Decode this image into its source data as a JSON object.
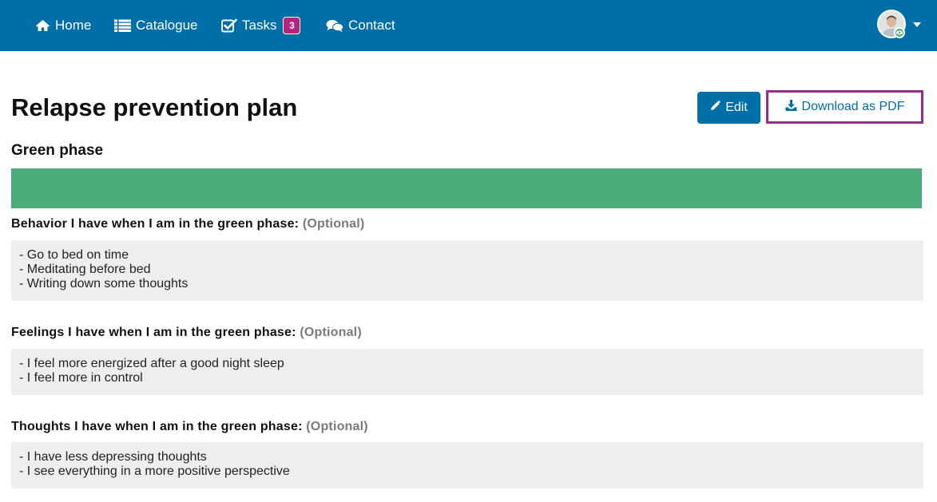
{
  "nav": {
    "home": "Home",
    "catalogue": "Catalogue",
    "tasks": "Tasks",
    "tasks_badge": "3",
    "contact": "Contact"
  },
  "page": {
    "title": "Relapse prevention plan",
    "edit_label": "Edit",
    "download_label": "Download as PDF"
  },
  "phase": {
    "title": "Green phase",
    "color": "#4aab79"
  },
  "fields": [
    {
      "label": "Behavior I have when I am in the green phase:",
      "optional": "(Optional)",
      "lines": [
        "- Go to bed on time",
        "- Meditating before bed",
        "- Writing down some thoughts"
      ]
    },
    {
      "label": "Feelings I have when I am in the green phase:",
      "optional": "(Optional)",
      "lines": [
        "- I feel more energized after a good night sleep",
        "- I feel more in control"
      ]
    },
    {
      "label": "Thoughts I have when I am in the green phase:",
      "optional": "(Optional)",
      "lines": [
        "- I have less depressing thoughts",
        "- I see everything in a more positive perspective"
      ]
    }
  ],
  "colors": {
    "navbar": "#006ea7",
    "badge": "#b4247f",
    "highlight_border": "#9b2a88",
    "field_bg": "#eeeeee"
  },
  "icons": {
    "home": "home-icon",
    "catalogue": "list-icon",
    "tasks": "checkbox-icon",
    "contact": "chat-icon",
    "edit": "pencil-icon",
    "download": "download-icon",
    "avatar_status": "eye-icon"
  }
}
